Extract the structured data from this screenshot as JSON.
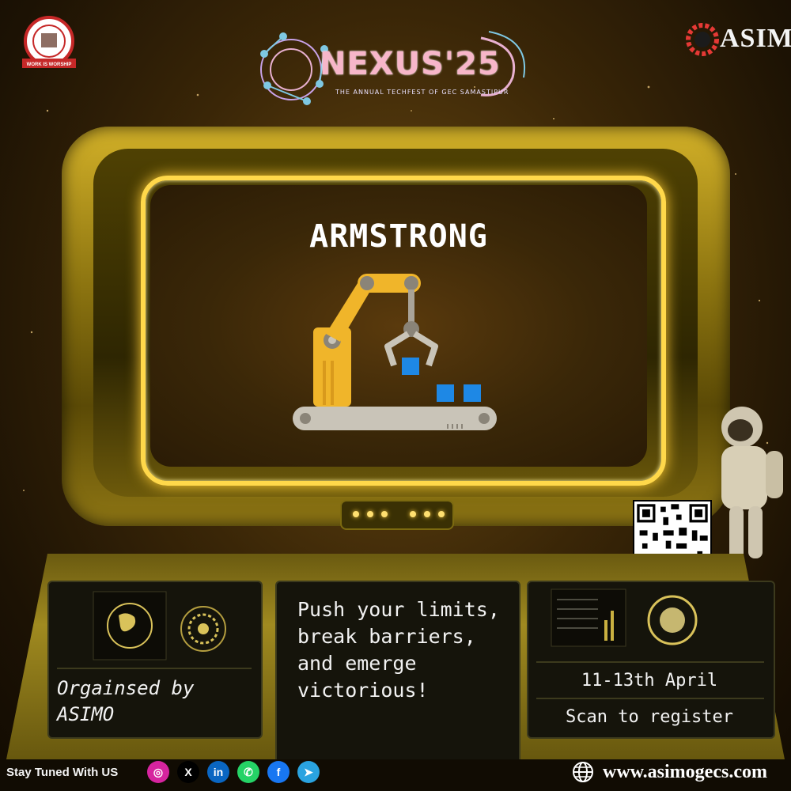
{
  "header": {
    "college_logo_text": "WORK IS WORSHIP",
    "event_name": "NEXUS'25",
    "event_tagline": "THE ANNUAL TECHFEST OF GEC SAMASTIPUR",
    "organizer_logo": "ASIMO"
  },
  "screen": {
    "title": "ARMSTRONG",
    "illustration": "robotic-arm-icon"
  },
  "panels": {
    "organised": "Orgainsed by\nASIMO",
    "motto": "Push your limits, break barriers, and emerge victorious!",
    "dates": "11-13th April",
    "scan": "Scan to register"
  },
  "footer": {
    "stay_tuned": "Stay Tuned With US",
    "socials": [
      {
        "name": "instagram-icon",
        "glyph": "◎",
        "color": "#d6249f"
      },
      {
        "name": "x-icon",
        "glyph": "X",
        "color": "#000000"
      },
      {
        "name": "linkedin-icon",
        "glyph": "in",
        "color": "#0a66c2"
      },
      {
        "name": "whatsapp-icon",
        "glyph": "✆",
        "color": "#25d366"
      },
      {
        "name": "facebook-icon",
        "glyph": "f",
        "color": "#1877f2"
      },
      {
        "name": "telegram-icon",
        "glyph": "➤",
        "color": "#2aa3e0"
      }
    ],
    "website": "www.asimogecs.com"
  },
  "colors": {
    "accent_gold": "#ffd84a",
    "arm_yellow": "#f0b52a",
    "cube_blue": "#1e88e5"
  }
}
